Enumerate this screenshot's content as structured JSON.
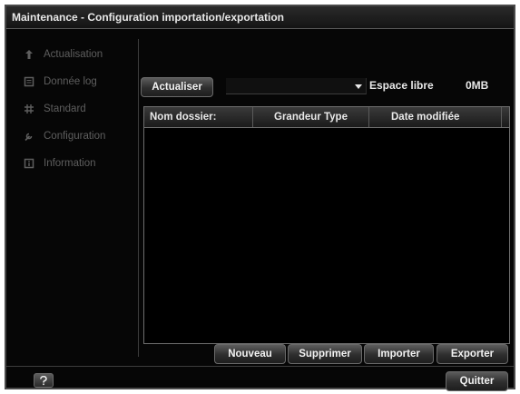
{
  "window": {
    "title": "Maintenance - Configuration importation/exportation"
  },
  "sidebar": {
    "items": [
      {
        "label": "Actualisation",
        "icon": "upload-arrow-icon"
      },
      {
        "label": "Donnée log",
        "icon": "log-icon"
      },
      {
        "label": "Standard",
        "icon": "hash-icon"
      },
      {
        "label": "Configuration",
        "icon": "wrench-icon"
      },
      {
        "label": "Information",
        "icon": "info-icon"
      }
    ]
  },
  "toolbar": {
    "refresh_label": "Actualiser",
    "device_select_value": "",
    "free_space_label": "Espace libre",
    "free_space_value": "0MB"
  },
  "table": {
    "columns": [
      "Nom dossier:",
      "Grandeur Type",
      "Date modifiée"
    ],
    "rows": []
  },
  "actions": {
    "new_label": "Nouveau",
    "delete_label": "Supprimer",
    "import_label": "Importer",
    "export_label": "Exporter"
  },
  "footer": {
    "quit_label": "Quitter"
  },
  "colors": {
    "background": "#060606",
    "text": "#e8e8e8",
    "disabled_text": "#5e5e5e",
    "border": "#6e6e6e"
  }
}
